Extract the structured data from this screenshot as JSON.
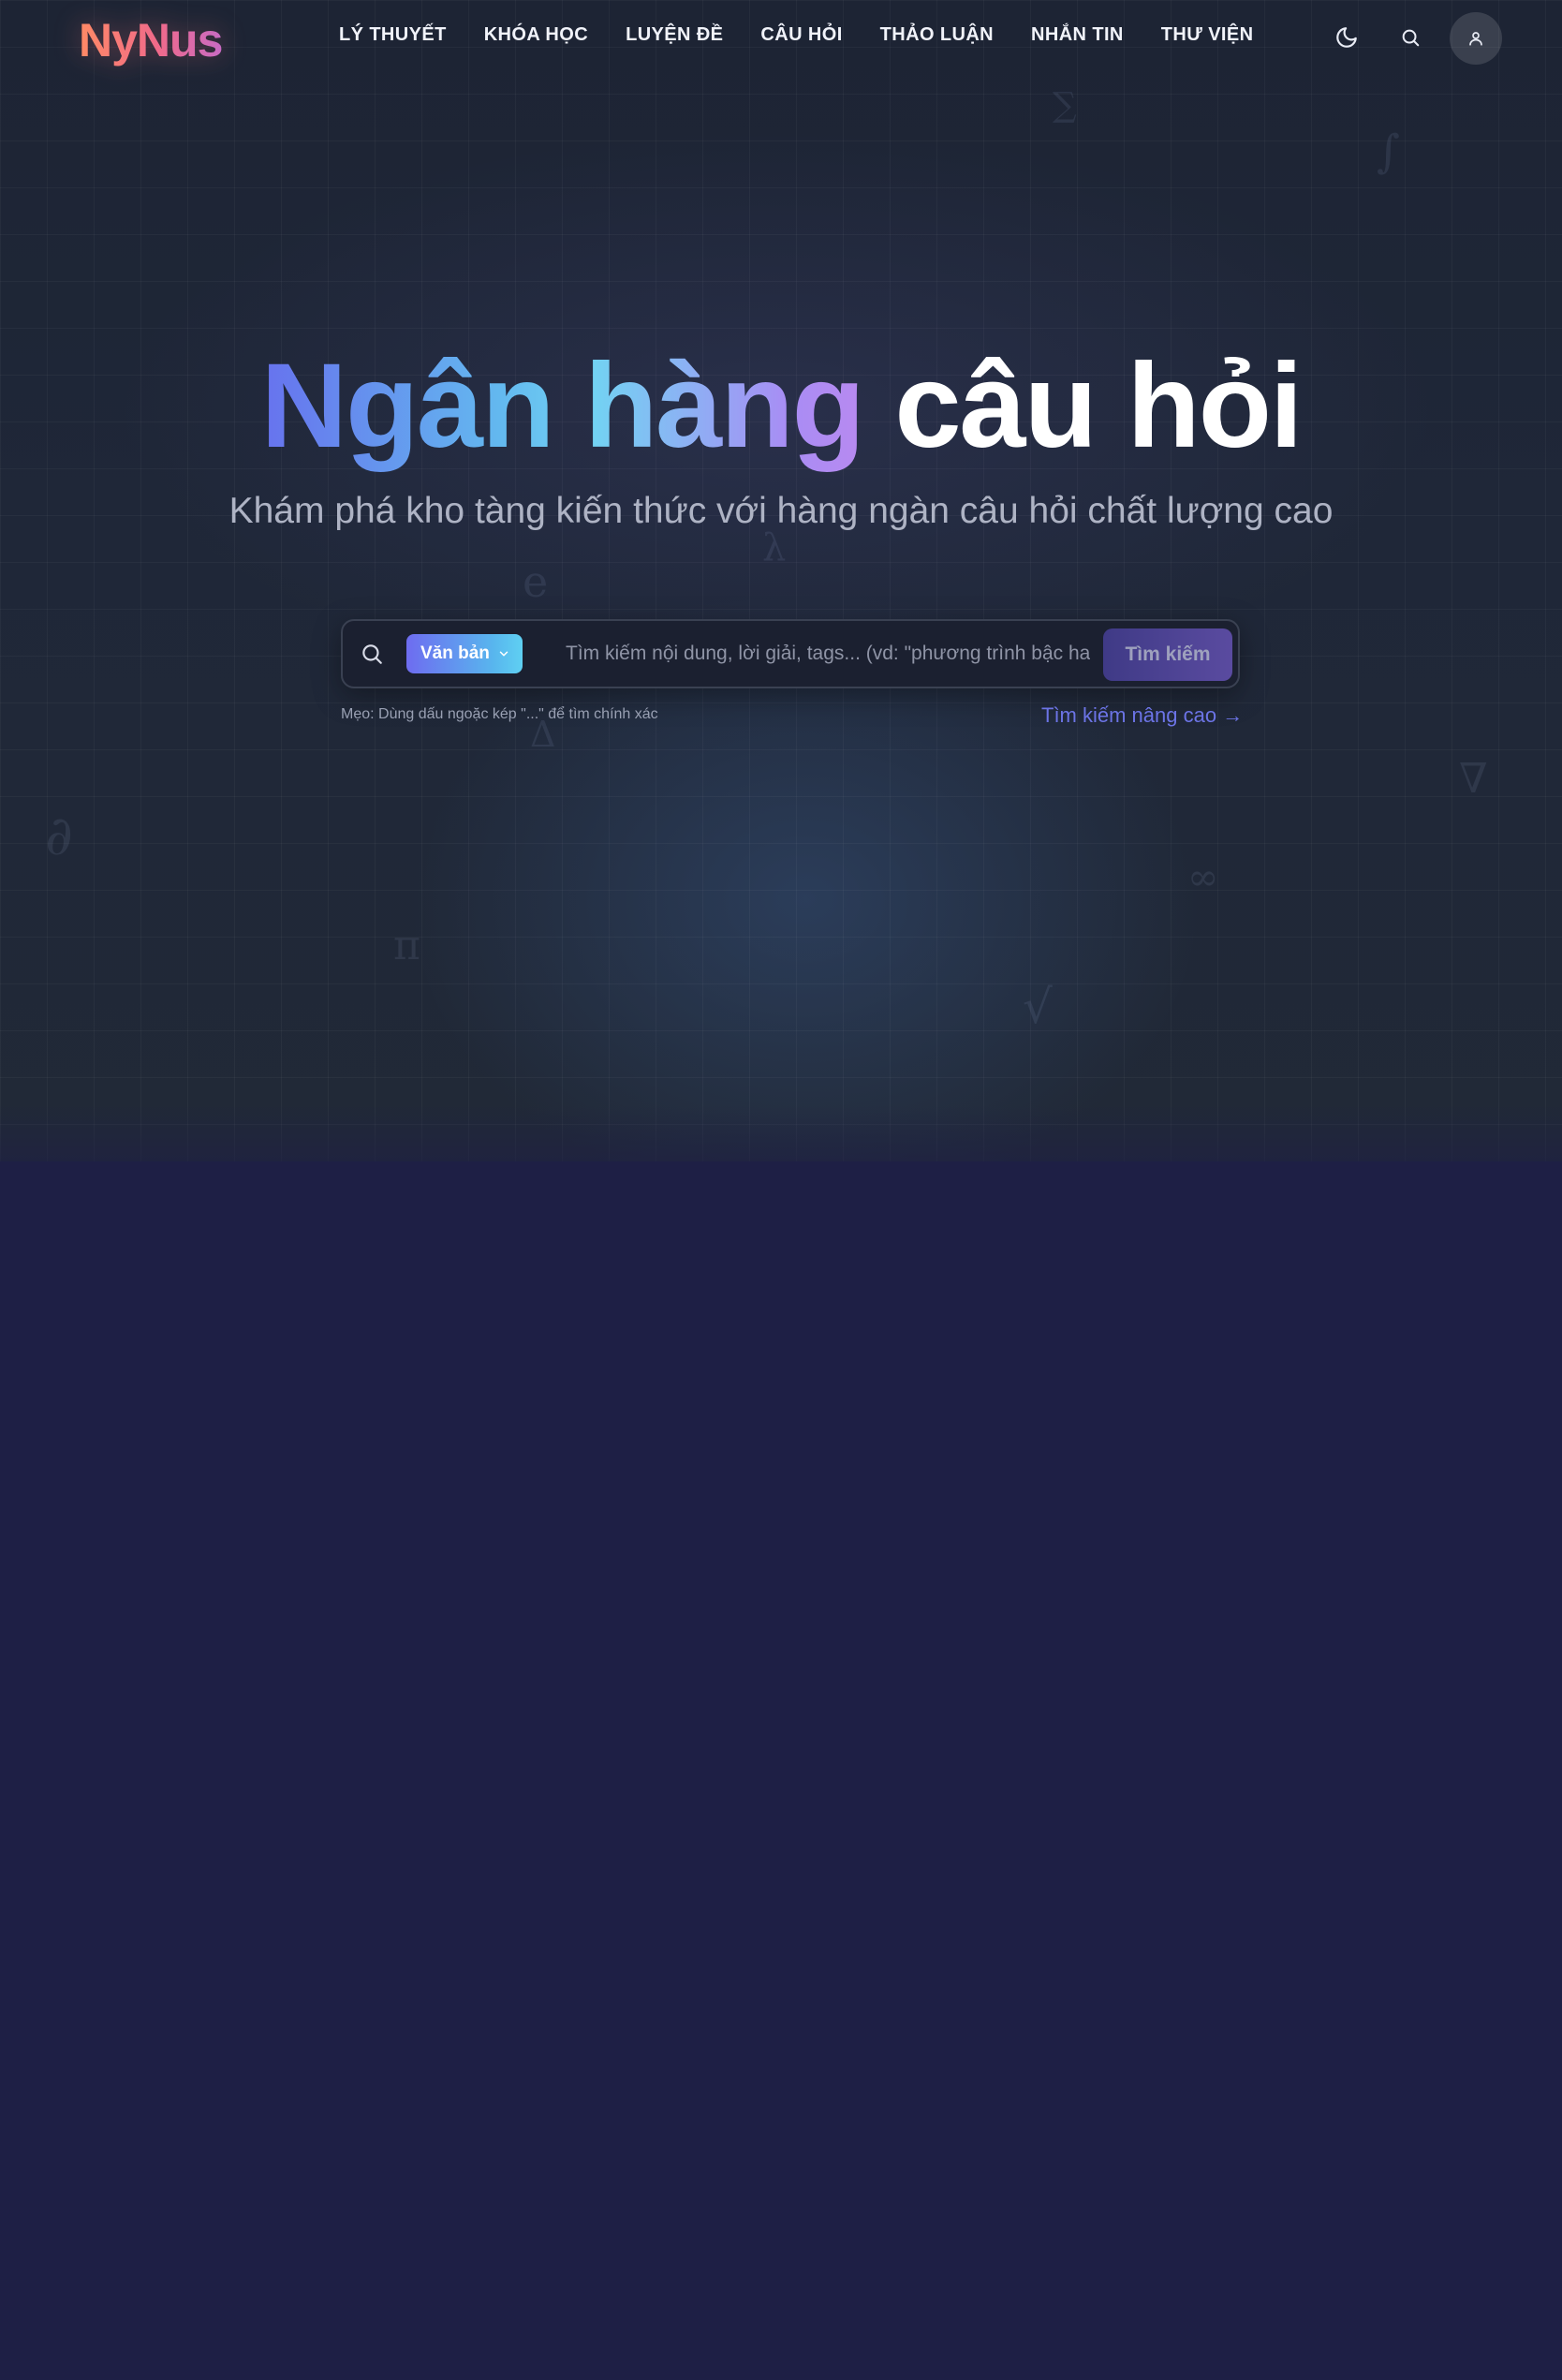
{
  "brand": {
    "logo": "NyNus"
  },
  "nav": {
    "items": [
      {
        "label": "LÝ THUYẾT"
      },
      {
        "label": "KHÓA HỌC"
      },
      {
        "label": "LUYỆN ĐỀ"
      },
      {
        "label": "CÂU HỎI"
      },
      {
        "label": "THẢO LUẬN"
      },
      {
        "label": "NHẮN TIN"
      },
      {
        "label": "THƯ VIỆN"
      }
    ],
    "icons": {
      "theme": "moon-icon",
      "search": "search-icon",
      "user": "user-icon"
    }
  },
  "hero": {
    "title_gradient": "Ngân hàng",
    "title_plain": "câu hỏi",
    "subtitle": "Khám phá kho tàng kiến thức với hàng ngàn câu hỏi chất lượng cao",
    "math_symbols": [
      "∑",
      "∫",
      "λ",
      "e",
      "Δ",
      "∂",
      "π",
      "∞",
      "√",
      "∇"
    ]
  },
  "search": {
    "mode_label": "Văn bản",
    "placeholder": "Tìm kiếm nội dung, lời giải, tags... (vd: \"phương trình bậc hai\")",
    "value": "",
    "submit_label": "Tìm kiếm",
    "tip": "Mẹo: Dùng dấu ngoặc kép \"...\" để tìm chính xác",
    "advanced_label": "Tìm kiếm nâng cao →"
  },
  "colors": {
    "page_bg": "#1e1f45",
    "hero_bg": "#1f2738",
    "accent": "#6c74e6",
    "logo_gradient": [
      "#ff8a65",
      "#c86bc4"
    ],
    "title_gradient": [
      "#6772ee",
      "#72d3f3",
      "#b88af0"
    ]
  }
}
